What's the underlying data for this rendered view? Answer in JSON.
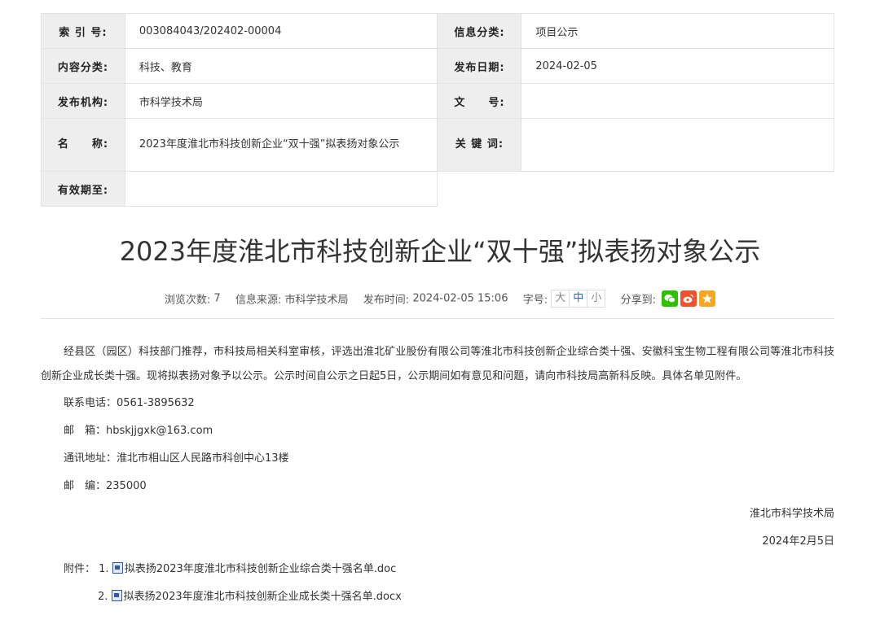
{
  "meta": {
    "index_label": "索 引 号:",
    "index_value": "003084043/202402-00004",
    "info_cat_label": "信息分类:",
    "info_cat_value": "项目公示",
    "content_cat_label": "内容分类:",
    "content_cat_value": "科技、教育",
    "date_label": "发布日期:",
    "date_value": "2024-02-05",
    "org_label": "发布机构:",
    "org_value": "市科学技术局",
    "docno_label": "文　　号:",
    "docno_value": "",
    "name_label": "名　　称:",
    "name_value": "2023年度淮北市科技创新企业“双十强”拟表扬对象公示",
    "keywords_label": "关 键 词:",
    "keywords_value": "",
    "valid_label": "有效期至:",
    "valid_value": ""
  },
  "title": "2023年度淮北市科技创新企业“双十强”拟表扬对象公示",
  "info": {
    "views_label": "浏览次数:",
    "views_value": "7",
    "source_label": "信息来源:",
    "source_value": "市科学技术局",
    "time_label": "发布时间:",
    "time_value": "2024-02-05 15:06",
    "font_label": "字号:",
    "font_large": "大",
    "font_medium": "中",
    "font_small": "小",
    "share_label": "分享到:",
    "share_icons": [
      "wechat-icon",
      "weibo-icon",
      "favorite-icon"
    ],
    "colors": {
      "wechat": "#2dc100",
      "weibo": "#f0522d",
      "favorite": "#f5a623"
    }
  },
  "body": {
    "paragraph": "经县区（园区）科技部门推荐，市科技局相关科室审核，评选出淮北矿业股份有限公司等淮北市科技创新企业综合类十强、安徽科宝生物工程有限公司等淮北市科技创新企业成长类十强。现将拟表扬对象予以公示。公示时间自公示之日起5日，公示期间如有意见和问题，请向市科技局高新科反映。具体名单见附件。",
    "phone": "联系电话：0561-3895632",
    "email": "邮　箱：hbskjjgxk@163.com",
    "address": "通讯地址：淮北市相山区人民路市科创中心13楼",
    "postcode": "邮　编：235000",
    "signer": "淮北市科学技术局",
    "sign_date": "2024年2月5日",
    "attach_label": "附件：",
    "attachments": [
      {
        "num": "1.",
        "name": "拟表扬2023年度淮北市科技创新企业综合类十强名单.doc"
      },
      {
        "num": "2.",
        "name": "拟表扬2023年度淮北市科技创新企业成长类十强名单.docx"
      }
    ]
  }
}
